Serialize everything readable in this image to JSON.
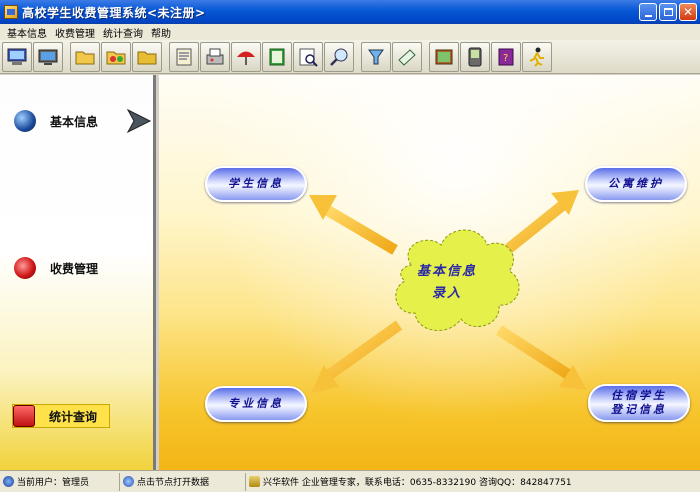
{
  "window": {
    "title": "高校学生收费管理系统<未注册>"
  },
  "menu": [
    "基本信息",
    "收费管理",
    "统计查询",
    "帮助"
  ],
  "toolbar": {
    "buttons": [
      "computer-icon",
      "monitor-icon",
      "folder-icon",
      "network-folder-icon",
      "folder-open-icon",
      "scroll-icon",
      "fax-icon",
      "umbrella-icon",
      "book-icon",
      "zoom-document-icon",
      "magnifier-icon",
      "funnel-icon",
      "paper-icon",
      "picture-frame-icon",
      "pda-icon",
      "help-book-icon",
      "runner-icon"
    ]
  },
  "sidebar": {
    "items": [
      {
        "label": "基本信息",
        "icon": "globe-icon"
      },
      {
        "label": "收费管理",
        "icon": "red-ball-icon"
      },
      {
        "label": "统计查询",
        "icon": "toolbox-icon"
      }
    ]
  },
  "diagram": {
    "center": "基本信息录入",
    "center_lines": [
      "基本信息",
      "录入"
    ],
    "nodes": {
      "student": "学生信息",
      "dorm": "公寓维护",
      "major": "专业信息",
      "dorm_reg_line1": "住宿学生",
      "dorm_reg_line2": "登记信息"
    }
  },
  "status": {
    "user": "当前用户：管理员",
    "hint": "点击节点打开数据",
    "company": "兴华软件 企业管理专家，联系电话：0635-8332190  咨询QQ：842847751"
  },
  "colors": {
    "titlebar": "#0a5ad6",
    "canvas_bottom": "#f3b516",
    "arrow": "#f6c030",
    "pill_text": "#101090",
    "cloud": "#e6f04a"
  }
}
